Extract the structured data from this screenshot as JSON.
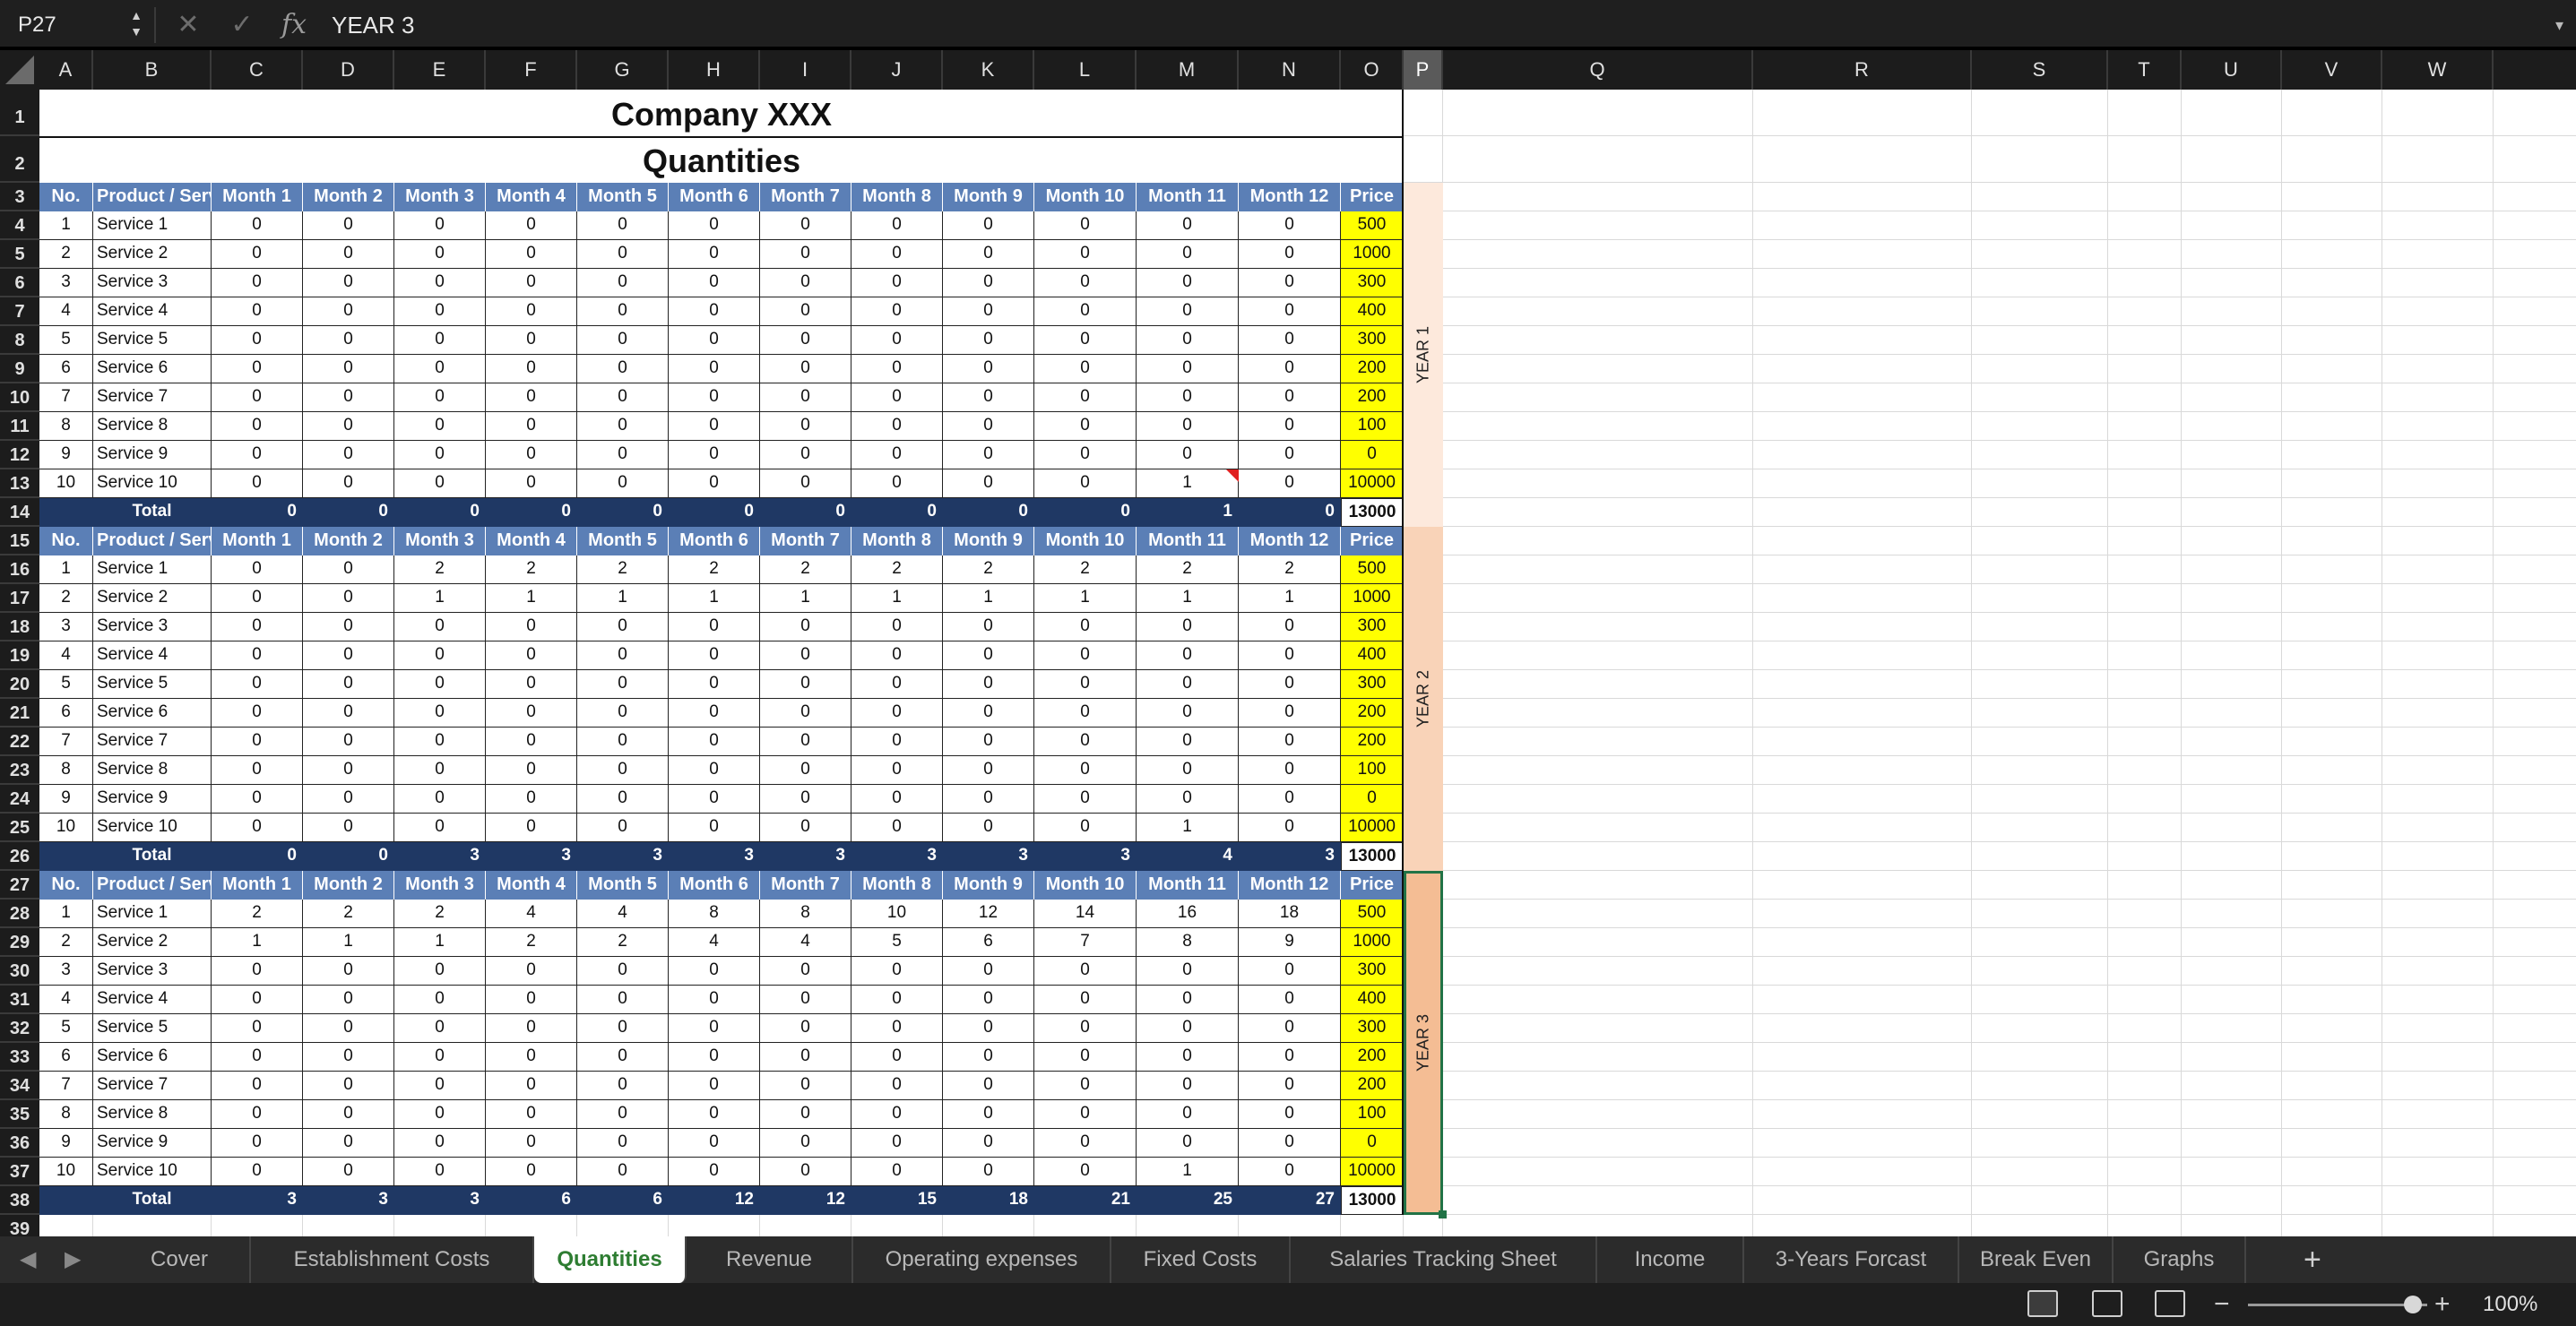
{
  "formula_bar": {
    "name_box": "P27",
    "cancel_icon": "close-icon",
    "confirm_icon": "check-icon",
    "fx_label": "fx",
    "formula": "YEAR 3"
  },
  "columns": [
    "A",
    "B",
    "C",
    "D",
    "E",
    "F",
    "G",
    "H",
    "I",
    "J",
    "K",
    "L",
    "M",
    "N",
    "O",
    "P",
    "Q",
    "R",
    "S",
    "T",
    "U",
    "V",
    "W"
  ],
  "selected_column": "P",
  "rows": [
    "1",
    "2",
    "3",
    "4",
    "5",
    "6",
    "7",
    "8",
    "9",
    "10",
    "11",
    "12",
    "13",
    "14",
    "15",
    "16",
    "17",
    "18",
    "19",
    "20",
    "21",
    "22",
    "23",
    "24",
    "25",
    "26",
    "27",
    "28",
    "29",
    "30",
    "31",
    "32",
    "33",
    "34",
    "35",
    "36",
    "37",
    "38",
    "39"
  ],
  "sheet": {
    "title": "Company XXX",
    "subtitle": "Quantities",
    "headers": [
      "No.",
      "Product / Service",
      "Month 1",
      "Month 2",
      "Month 3",
      "Month 4",
      "Month 5",
      "Month 6",
      "Month 7",
      "Month 8",
      "Month 9",
      "Month 10",
      "Month 11",
      "Month 12",
      "Price"
    ],
    "total_label": "Total",
    "years": [
      {
        "label": "YEAR 1",
        "band_color": "#fde9dc",
        "rows": [
          {
            "no": "1",
            "name": "Service 1",
            "months": [
              "0",
              "0",
              "0",
              "0",
              "0",
              "0",
              "0",
              "0",
              "0",
              "0",
              "0",
              "0"
            ],
            "price": "500"
          },
          {
            "no": "2",
            "name": "Service 2",
            "months": [
              "0",
              "0",
              "0",
              "0",
              "0",
              "0",
              "0",
              "0",
              "0",
              "0",
              "0",
              "0"
            ],
            "price": "1000"
          },
          {
            "no": "3",
            "name": "Service 3",
            "months": [
              "0",
              "0",
              "0",
              "0",
              "0",
              "0",
              "0",
              "0",
              "0",
              "0",
              "0",
              "0"
            ],
            "price": "300"
          },
          {
            "no": "4",
            "name": "Service 4",
            "months": [
              "0",
              "0",
              "0",
              "0",
              "0",
              "0",
              "0",
              "0",
              "0",
              "0",
              "0",
              "0"
            ],
            "price": "400"
          },
          {
            "no": "5",
            "name": "Service 5",
            "months": [
              "0",
              "0",
              "0",
              "0",
              "0",
              "0",
              "0",
              "0",
              "0",
              "0",
              "0",
              "0"
            ],
            "price": "300"
          },
          {
            "no": "6",
            "name": "Service 6",
            "months": [
              "0",
              "0",
              "0",
              "0",
              "0",
              "0",
              "0",
              "0",
              "0",
              "0",
              "0",
              "0"
            ],
            "price": "200"
          },
          {
            "no": "7",
            "name": "Service 7",
            "months": [
              "0",
              "0",
              "0",
              "0",
              "0",
              "0",
              "0",
              "0",
              "0",
              "0",
              "0",
              "0"
            ],
            "price": "200"
          },
          {
            "no": "8",
            "name": "Service 8",
            "months": [
              "0",
              "0",
              "0",
              "0",
              "0",
              "0",
              "0",
              "0",
              "0",
              "0",
              "0",
              "0"
            ],
            "price": "100"
          },
          {
            "no": "9",
            "name": "Service 9",
            "months": [
              "0",
              "0",
              "0",
              "0",
              "0",
              "0",
              "0",
              "0",
              "0",
              "0",
              "0",
              "0"
            ],
            "price": "0"
          },
          {
            "no": "10",
            "name": "Service 10",
            "months": [
              "0",
              "0",
              "0",
              "0",
              "0",
              "0",
              "0",
              "0",
              "0",
              "0",
              "1",
              "0"
            ],
            "price": "10000"
          }
        ],
        "totals": [
          "0",
          "0",
          "0",
          "0",
          "0",
          "0",
          "0",
          "0",
          "0",
          "0",
          "1",
          "0"
        ],
        "total_price": "13000"
      },
      {
        "label": "YEAR 2",
        "band_color": "#f9d3b8",
        "rows": [
          {
            "no": "1",
            "name": "Service 1",
            "months": [
              "0",
              "0",
              "2",
              "2",
              "2",
              "2",
              "2",
              "2",
              "2",
              "2",
              "2",
              "2"
            ],
            "price": "500"
          },
          {
            "no": "2",
            "name": "Service 2",
            "months": [
              "0",
              "0",
              "1",
              "1",
              "1",
              "1",
              "1",
              "1",
              "1",
              "1",
              "1",
              "1"
            ],
            "price": "1000"
          },
          {
            "no": "3",
            "name": "Service 3",
            "months": [
              "0",
              "0",
              "0",
              "0",
              "0",
              "0",
              "0",
              "0",
              "0",
              "0",
              "0",
              "0"
            ],
            "price": "300"
          },
          {
            "no": "4",
            "name": "Service 4",
            "months": [
              "0",
              "0",
              "0",
              "0",
              "0",
              "0",
              "0",
              "0",
              "0",
              "0",
              "0",
              "0"
            ],
            "price": "400"
          },
          {
            "no": "5",
            "name": "Service 5",
            "months": [
              "0",
              "0",
              "0",
              "0",
              "0",
              "0",
              "0",
              "0",
              "0",
              "0",
              "0",
              "0"
            ],
            "price": "300"
          },
          {
            "no": "6",
            "name": "Service 6",
            "months": [
              "0",
              "0",
              "0",
              "0",
              "0",
              "0",
              "0",
              "0",
              "0",
              "0",
              "0",
              "0"
            ],
            "price": "200"
          },
          {
            "no": "7",
            "name": "Service 7",
            "months": [
              "0",
              "0",
              "0",
              "0",
              "0",
              "0",
              "0",
              "0",
              "0",
              "0",
              "0",
              "0"
            ],
            "price": "200"
          },
          {
            "no": "8",
            "name": "Service 8",
            "months": [
              "0",
              "0",
              "0",
              "0",
              "0",
              "0",
              "0",
              "0",
              "0",
              "0",
              "0",
              "0"
            ],
            "price": "100"
          },
          {
            "no": "9",
            "name": "Service 9",
            "months": [
              "0",
              "0",
              "0",
              "0",
              "0",
              "0",
              "0",
              "0",
              "0",
              "0",
              "0",
              "0"
            ],
            "price": "0"
          },
          {
            "no": "10",
            "name": "Service 10",
            "months": [
              "0",
              "0",
              "0",
              "0",
              "0",
              "0",
              "0",
              "0",
              "0",
              "0",
              "1",
              "0"
            ],
            "price": "10000"
          }
        ],
        "totals": [
          "0",
          "0",
          "3",
          "3",
          "3",
          "3",
          "3",
          "3",
          "3",
          "3",
          "4",
          "3"
        ],
        "total_price": "13000"
      },
      {
        "label": "YEAR 3",
        "band_color": "#f4bd94",
        "rows": [
          {
            "no": "1",
            "name": "Service 1",
            "months": [
              "2",
              "2",
              "2",
              "4",
              "4",
              "8",
              "8",
              "10",
              "12",
              "14",
              "16",
              "18"
            ],
            "price": "500"
          },
          {
            "no": "2",
            "name": "Service 2",
            "months": [
              "1",
              "1",
              "1",
              "2",
              "2",
              "4",
              "4",
              "5",
              "6",
              "7",
              "8",
              "9"
            ],
            "price": "1000"
          },
          {
            "no": "3",
            "name": "Service 3",
            "months": [
              "0",
              "0",
              "0",
              "0",
              "0",
              "0",
              "0",
              "0",
              "0",
              "0",
              "0",
              "0"
            ],
            "price": "300"
          },
          {
            "no": "4",
            "name": "Service 4",
            "months": [
              "0",
              "0",
              "0",
              "0",
              "0",
              "0",
              "0",
              "0",
              "0",
              "0",
              "0",
              "0"
            ],
            "price": "400"
          },
          {
            "no": "5",
            "name": "Service 5",
            "months": [
              "0",
              "0",
              "0",
              "0",
              "0",
              "0",
              "0",
              "0",
              "0",
              "0",
              "0",
              "0"
            ],
            "price": "300"
          },
          {
            "no": "6",
            "name": "Service 6",
            "months": [
              "0",
              "0",
              "0",
              "0",
              "0",
              "0",
              "0",
              "0",
              "0",
              "0",
              "0",
              "0"
            ],
            "price": "200"
          },
          {
            "no": "7",
            "name": "Service 7",
            "months": [
              "0",
              "0",
              "0",
              "0",
              "0",
              "0",
              "0",
              "0",
              "0",
              "0",
              "0",
              "0"
            ],
            "price": "200"
          },
          {
            "no": "8",
            "name": "Service 8",
            "months": [
              "0",
              "0",
              "0",
              "0",
              "0",
              "0",
              "0",
              "0",
              "0",
              "0",
              "0",
              "0"
            ],
            "price": "100"
          },
          {
            "no": "9",
            "name": "Service 9",
            "months": [
              "0",
              "0",
              "0",
              "0",
              "0",
              "0",
              "0",
              "0",
              "0",
              "0",
              "0",
              "0"
            ],
            "price": "0"
          },
          {
            "no": "10",
            "name": "Service 10",
            "months": [
              "0",
              "0",
              "0",
              "0",
              "0",
              "0",
              "0",
              "0",
              "0",
              "0",
              "1",
              "0"
            ],
            "price": "10000"
          }
        ],
        "totals": [
          "3",
          "3",
          "3",
          "6",
          "6",
          "12",
          "12",
          "15",
          "18",
          "21",
          "25",
          "27"
        ],
        "total_price": "13000"
      }
    ]
  },
  "tabs": [
    "Cover",
    "Establishment  Costs",
    "Quantities",
    "Revenue",
    "Operating expenses",
    "Fixed Costs",
    "Salaries Tracking Sheet",
    "Income",
    "3-Years Forcast",
    "Break Even",
    "Graphs"
  ],
  "active_tab": "Quantities",
  "add_tab_label": "+",
  "status": {
    "zoom_out": "−",
    "zoom_in": "+",
    "zoom_level": "100%",
    "zoom_fraction": 0.5
  },
  "colors": {
    "header_blue": "#5b7fb6",
    "total_navy": "#1f3864",
    "price_yellow": "#ffff00",
    "active_tab_green": "#2e7d32",
    "selection_green": "#217346"
  }
}
